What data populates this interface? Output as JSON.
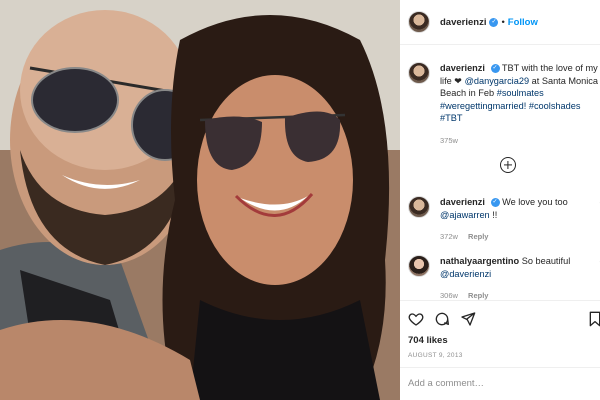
{
  "post": {
    "username": "daverienzi",
    "follow_label": "Follow",
    "caption_text": "TBT with the love of my life ❤",
    "caption_mention": "@danygarcia29",
    "caption_text2": " at Santa Monica Beach in Feb ",
    "caption_tags": "#soulmates #weregettingmarried! #coolshades #TBT",
    "caption_time": "375w",
    "likes": "704 likes",
    "date": "AUGUST 9, 2013",
    "add_comment_placeholder": "Add a comment…"
  },
  "comments": [
    {
      "username": "daverienzi",
      "text": "We love you too ",
      "mention": "@ajawarren",
      "suffix": " !!",
      "time": "372w",
      "reply": "Reply"
    },
    {
      "username": "nathalyaargentino",
      "text": "So beautiful ",
      "mention": "@daverienzi",
      "suffix": "",
      "time": "306w",
      "reply": "Reply"
    }
  ],
  "colors": {
    "accent": "#0095f6",
    "verified": "#3897f0",
    "link": "#00376b",
    "muted": "#8e8e8e"
  },
  "icons": [
    "verified-badge-icon",
    "plus-circle-icon",
    "heart-icon",
    "comment-icon",
    "share-icon",
    "bookmark-icon"
  ]
}
